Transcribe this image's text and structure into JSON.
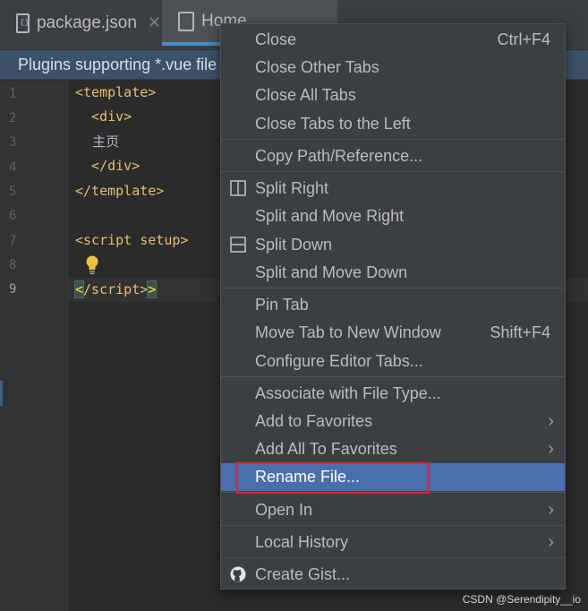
{
  "tabs": [
    {
      "label": "package.json",
      "file_icon_text": "{}",
      "close": "✕",
      "active": false
    },
    {
      "label": "Home",
      "file_icon_text": "",
      "active": true
    }
  ],
  "notification": {
    "text": "Plugins supporting *.vue file"
  },
  "editor": {
    "line_numbers": [
      "1",
      "2",
      "3",
      "4",
      "5",
      "6",
      "7",
      "8",
      "9"
    ],
    "active_line": "9",
    "code_lines": [
      "<template>",
      "  <div>",
      "    主页",
      "  </div>",
      "</template>",
      "",
      "<script setup>",
      "",
      "/script>"
    ],
    "bracket_open": "<",
    "bracket_close": ">",
    "intention_icon": "lightbulb-icon"
  },
  "context_menu": {
    "items": [
      {
        "label": "Close",
        "shortcut": "Ctrl+F4"
      },
      {
        "label": "Close Other Tabs"
      },
      {
        "label": "Close All Tabs"
      },
      {
        "label": "Close Tabs to the Left"
      },
      {
        "label": "Copy Path/Reference..."
      },
      {
        "label": "Split Right",
        "icon": "split-vertical-icon"
      },
      {
        "label": "Split and Move Right"
      },
      {
        "label": "Split Down",
        "icon": "split-horizontal-icon"
      },
      {
        "label": "Split and Move Down"
      },
      {
        "label": "Pin Tab"
      },
      {
        "label": "Move Tab to New Window",
        "shortcut": "Shift+F4"
      },
      {
        "label": "Configure Editor Tabs..."
      },
      {
        "label": "Associate with File Type..."
      },
      {
        "label": "Add to Favorites",
        "submenu": "›"
      },
      {
        "label": "Add All To Favorites",
        "submenu": "›"
      },
      {
        "label": "Rename File...",
        "selected": true
      },
      {
        "label": "Open In",
        "submenu": "›"
      },
      {
        "label": "Local History",
        "submenu": "›"
      },
      {
        "label": "Create Gist...",
        "icon": "github-icon"
      }
    ]
  },
  "watermark": "CSDN @Serendipity__io",
  "colors": {
    "selection": "#4b6eaf",
    "highlight_border": "#e0262a",
    "tag": "#e8bf6a",
    "notice_bg": "#3d5268"
  }
}
